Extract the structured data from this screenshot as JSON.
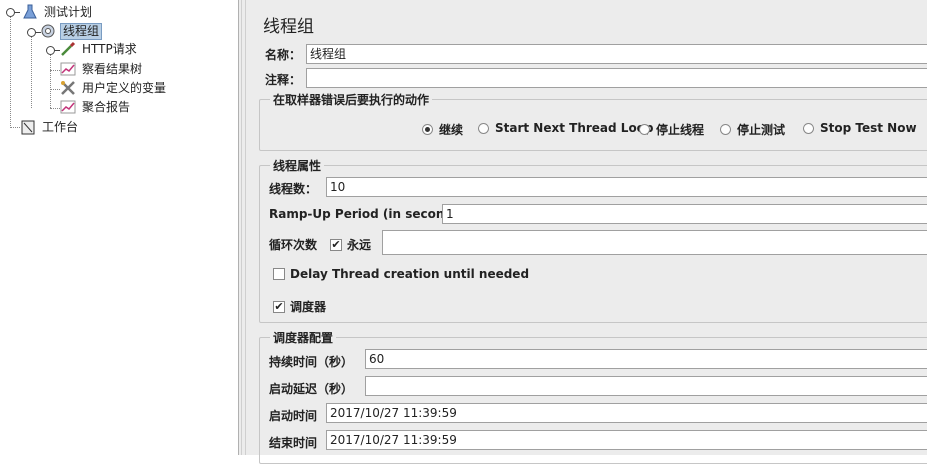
{
  "tree": {
    "root": "测试计划",
    "thread_group": "线程组",
    "http_request": "HTTP请求",
    "view_results_tree": "察看结果树",
    "user_defined_vars": "用户定义的变量",
    "aggregate_report": "聚合报告",
    "workbench": "工作台"
  },
  "panel": {
    "title": "线程组",
    "name_label": "名称：",
    "name_value": "线程组",
    "comment_label": "注释：",
    "comment_value": ""
  },
  "error_action": {
    "legend": "在取样器错误后要执行的动作",
    "options": [
      "继续",
      "Start Next Thread Loop",
      "停止线程",
      "停止测试",
      "Stop Test Now"
    ],
    "selected": "继续"
  },
  "thread_props": {
    "legend": "线程属性",
    "threads_label": "线程数：",
    "threads_value": "10",
    "rampup_label": "Ramp-Up Period (in seconds):",
    "rampup_value": "1",
    "loop_label": "循环次数",
    "forever_label": "永远",
    "forever_checked": true,
    "loop_value": "",
    "delay_label": "Delay Thread creation until needed",
    "delay_checked": false,
    "scheduler_label": "调度器",
    "scheduler_checked": true
  },
  "scheduler": {
    "legend": "调度器配置",
    "duration_label": "持续时间（秒）",
    "duration_value": "60",
    "delay_label": "启动延迟（秒）",
    "delay_value": "",
    "start_label": "启动时间",
    "start_value": "2017/10/27 11:39:59",
    "end_label": "结束时间",
    "end_value": "2017/10/27 11:39:59"
  },
  "icons": {
    "root": "flask-icon",
    "thread_group": "gear-icon",
    "http_request": "pipette-icon",
    "view_results_tree": "graph-icon",
    "user_defined_vars": "wrench-icon",
    "aggregate_report": "graph-icon",
    "workbench": "clipboard-icon"
  },
  "colors": {
    "selection": "#b8cfe5",
    "panel_bg": "#ececec"
  }
}
